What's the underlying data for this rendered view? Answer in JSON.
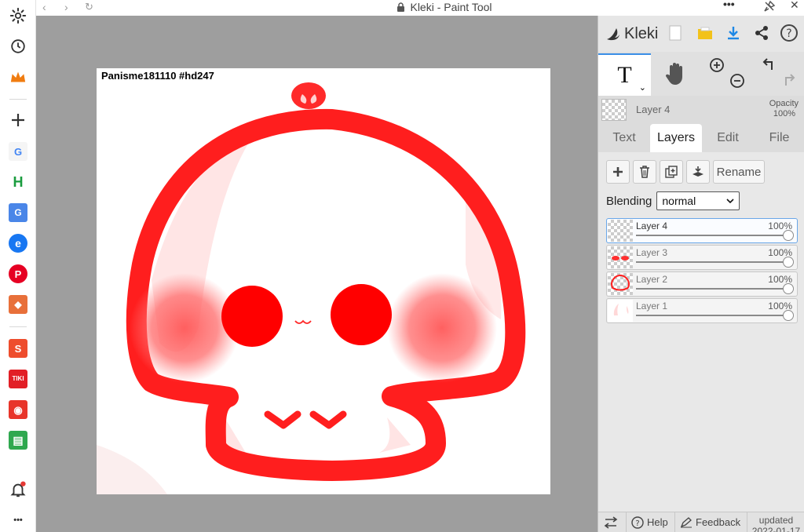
{
  "window": {
    "title": "Kleki - Paint Tool"
  },
  "browser_sidebar": {
    "items": [
      {
        "name": "settings-icon"
      },
      {
        "name": "history-icon"
      },
      {
        "name": "crown-icon"
      },
      {
        "name": "add-icon"
      },
      {
        "name": "google-app",
        "label": "G"
      },
      {
        "name": "h-app",
        "label": "H"
      },
      {
        "name": "translate-app",
        "label": "G"
      },
      {
        "name": "messenger-app",
        "label": "e"
      },
      {
        "name": "pinterest-app",
        "label": "P"
      },
      {
        "name": "cube-app",
        "label": "◆"
      },
      {
        "name": "shopee-app",
        "label": "S"
      },
      {
        "name": "tiki-app",
        "label": "TIKI"
      },
      {
        "name": "lazada-app",
        "label": "◉"
      },
      {
        "name": "sheet-app",
        "label": "▤"
      },
      {
        "name": "bell-icon"
      },
      {
        "name": "more-icon",
        "label": "•••"
      }
    ]
  },
  "canvas": {
    "label": "Panisme181110 #hd247",
    "colors": {
      "red": "#ff2020",
      "blush": "#ff5a5a",
      "eye": "#ff0000"
    }
  },
  "panel": {
    "brand": "Kleki",
    "active_tool_glyph": "T",
    "current_layer": {
      "name": "Layer 4",
      "opacity_label": "Opacity",
      "opacity": "100%"
    },
    "tabs": [
      {
        "label": "Text",
        "active": false
      },
      {
        "label": "Layers",
        "active": true
      },
      {
        "label": "Edit",
        "active": false
      },
      {
        "label": "File",
        "active": false
      }
    ],
    "layer_buttons": {
      "rename": "Rename"
    },
    "blending": {
      "label": "Blending",
      "value": "normal"
    },
    "layers": [
      {
        "name": "Layer 4",
        "opacity": "100%",
        "selected": true
      },
      {
        "name": "Layer 3",
        "opacity": "100%",
        "selected": false
      },
      {
        "name": "Layer 2",
        "opacity": "100%",
        "selected": false
      },
      {
        "name": "Layer 1",
        "opacity": "100%",
        "selected": false
      }
    ],
    "footer": {
      "help": "Help",
      "feedback": "Feedback",
      "updated": "updated",
      "date": "2022-01-17"
    }
  }
}
